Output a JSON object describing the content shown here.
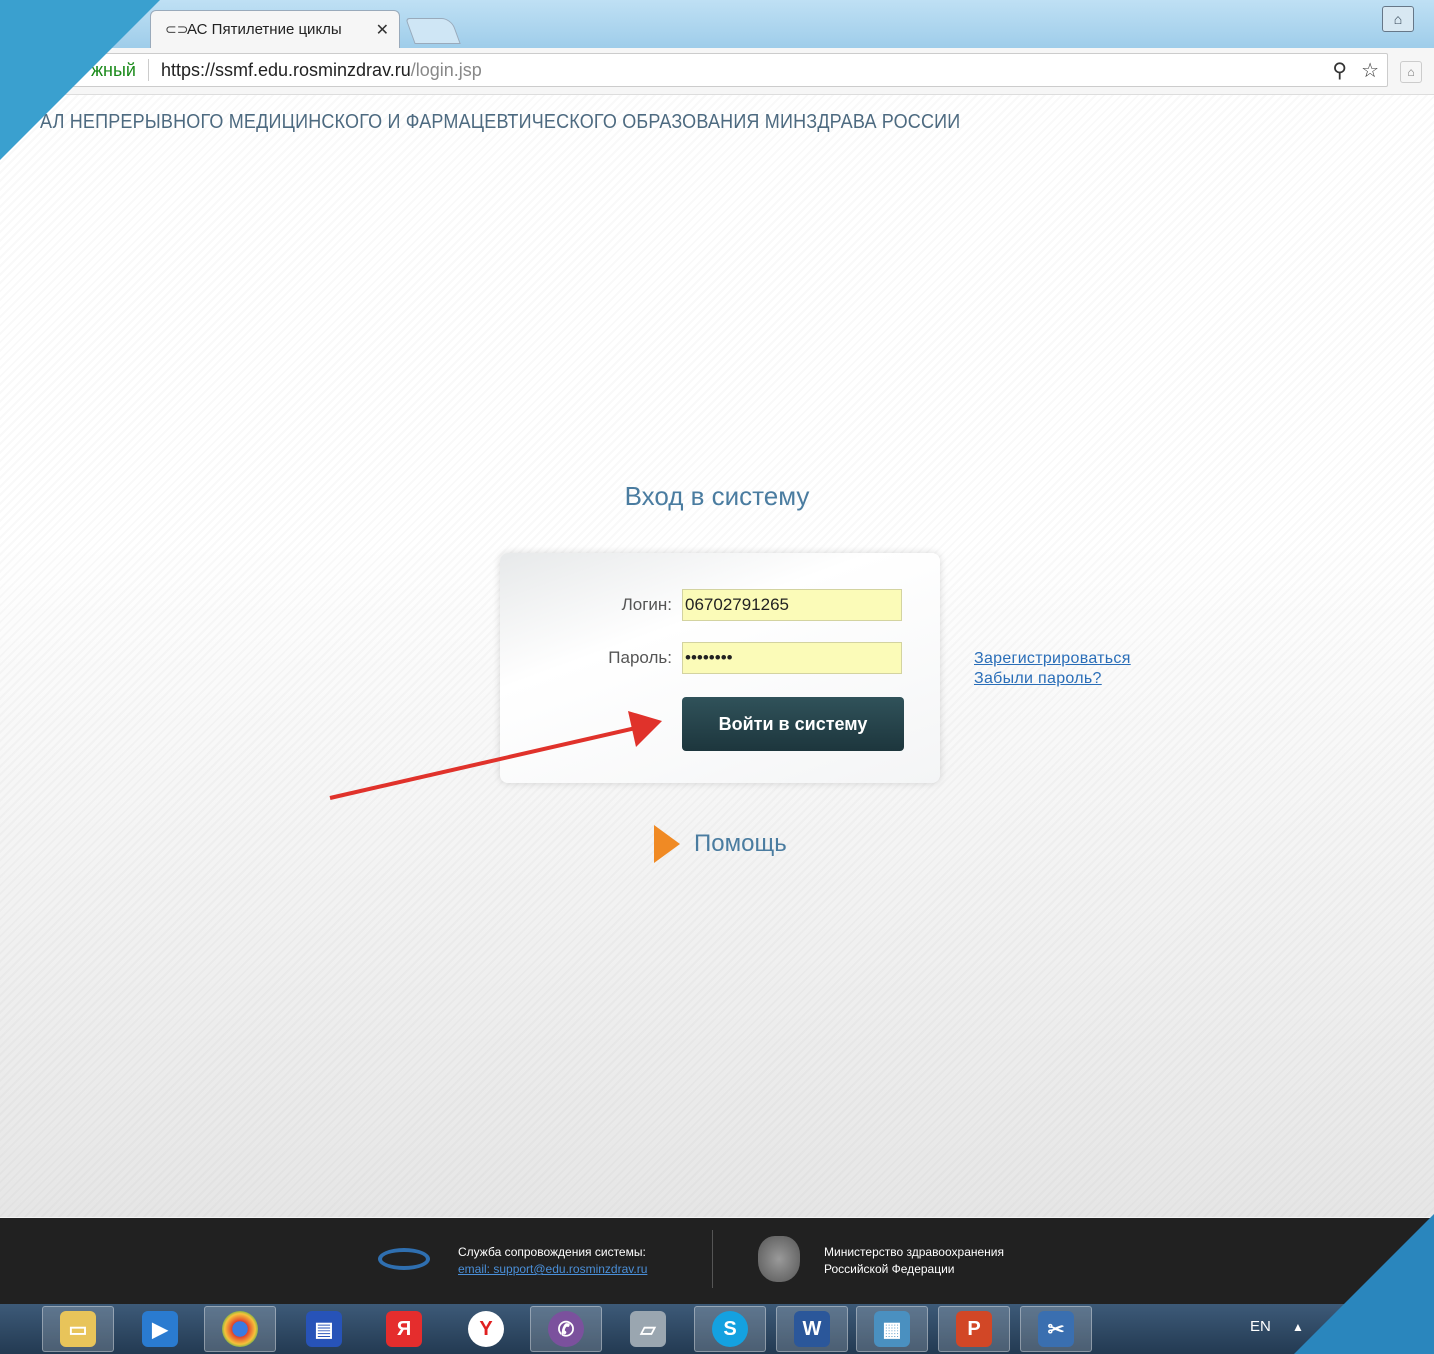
{
  "browser": {
    "tab_title": "АС Пятилетние циклы",
    "tab_close": "✕",
    "secure_label": "жный",
    "url_host": "https://ssmf.edu.rosminzdrav.ru",
    "url_path": "/login.jsp"
  },
  "page": {
    "portal_title": "АЛ НЕПРЕРЫВНОГО МЕДИЦИНСКОГО И ФАРМАЦЕВТИЧЕСКОГО ОБРАЗОВАНИЯ МИНЗДРАВА РОССИИ",
    "login_heading": "Вход в систему",
    "login_label": "Логин:",
    "login_value": "06702791265",
    "password_label": "Пароль:",
    "password_value": "••••••••",
    "submit_label": "Войти в систему",
    "register_link": "Зарегистрироваться",
    "forgot_link": "Забыли пароль?",
    "help_label": "Помощь"
  },
  "footer": {
    "support_title": "Служба сопровождения системы:",
    "support_email": "email: support@edu.rosminzdrav.ru",
    "ministry_line1": "Министерство здравоохранения",
    "ministry_line2": "Российской Федерации"
  },
  "taskbar": {
    "language": "EN",
    "apps": [
      "file-explorer",
      "media-player",
      "chrome",
      "floppy-save",
      "yandex",
      "yandex-browser",
      "viber",
      "scanner",
      "skype",
      "word",
      "photo-viewer",
      "powerpoint",
      "snipping-tool"
    ]
  },
  "colors": {
    "accent_heading": "#4a7ca0",
    "button_bg": "#1d363d",
    "input_bg": "#fbfbb8",
    "help_arrow": "#f08a24",
    "annotation_arrow": "#e0322b"
  }
}
